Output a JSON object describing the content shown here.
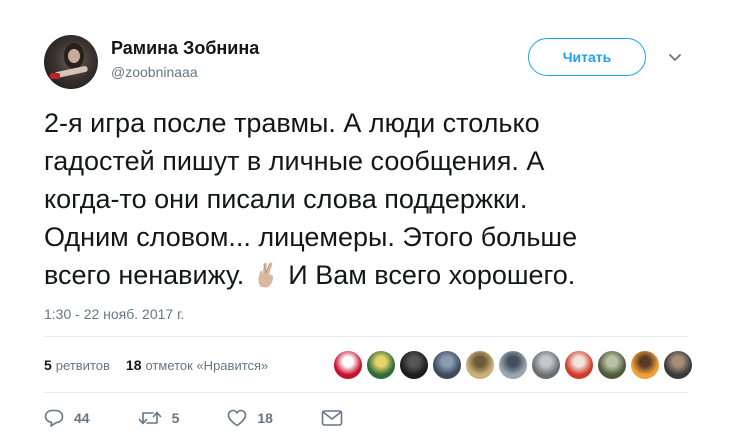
{
  "user": {
    "name": "Рамина Зобнина",
    "handle": "@zoobninaaa"
  },
  "follow_button_label": "Читать",
  "tweet": {
    "lines": [
      "2-я игра после травмы. А люди столько",
      "гадостей пишут в личные сообщения. А",
      "когда-то они писали слова поддержки.",
      "Одним словом... лицемеры. Этого больше"
    ],
    "last_line_before_emoji": "всего ненавижу.",
    "emoji": "crossed-fingers-emoji",
    "last_line_after_emoji": "И Вам всего хорошего."
  },
  "timestamp": "1:30 - 22 нояб. 2017 г.",
  "stats": {
    "retweets_count": "5",
    "retweets_label": "ретвитов",
    "likes_count": "18",
    "likes_label": "отметок «Нравится»"
  },
  "liker_avatars": [
    {
      "icon": "spartak-logo-avatar",
      "colors": [
        "#c8102e",
        "#ffffff"
      ]
    },
    {
      "icon": "team-crest-avatar",
      "colors": [
        "#2e6b3a",
        "#e8d36a"
      ]
    },
    {
      "icon": "dark-photo-avatar",
      "colors": [
        "#1c1c1c",
        "#555555"
      ]
    },
    {
      "icon": "person-photo-avatar",
      "colors": [
        "#3b4a5c",
        "#8c9bb0"
      ]
    },
    {
      "icon": "group-photo-avatar",
      "colors": [
        "#c9b27a",
        "#6d5a3a"
      ]
    },
    {
      "icon": "stadium-photo-avatar",
      "colors": [
        "#9aa6b2",
        "#44505c"
      ]
    },
    {
      "icon": "fans-photo-avatar",
      "colors": [
        "#6a6f74",
        "#c3c7cb"
      ]
    },
    {
      "icon": "red-shirt-avatar",
      "colors": [
        "#d23a2b",
        "#f1e4dc"
      ]
    },
    {
      "icon": "crowd-photo-avatar",
      "colors": [
        "#4d5b3c",
        "#b9c2a3"
      ]
    },
    {
      "icon": "sunset-photo-avatar",
      "colors": [
        "#f0a23a",
        "#5a3a24"
      ]
    },
    {
      "icon": "portrait-avatar",
      "colors": [
        "#3a3a3a",
        "#a58d7a"
      ]
    }
  ],
  "actions": {
    "reply_count": "44",
    "retweet_count": "5",
    "like_count": "18"
  },
  "colors": {
    "accent": "#1da1f2",
    "text": "#14171a",
    "secondary_text": "#657786",
    "divider": "#e6ecf0"
  }
}
